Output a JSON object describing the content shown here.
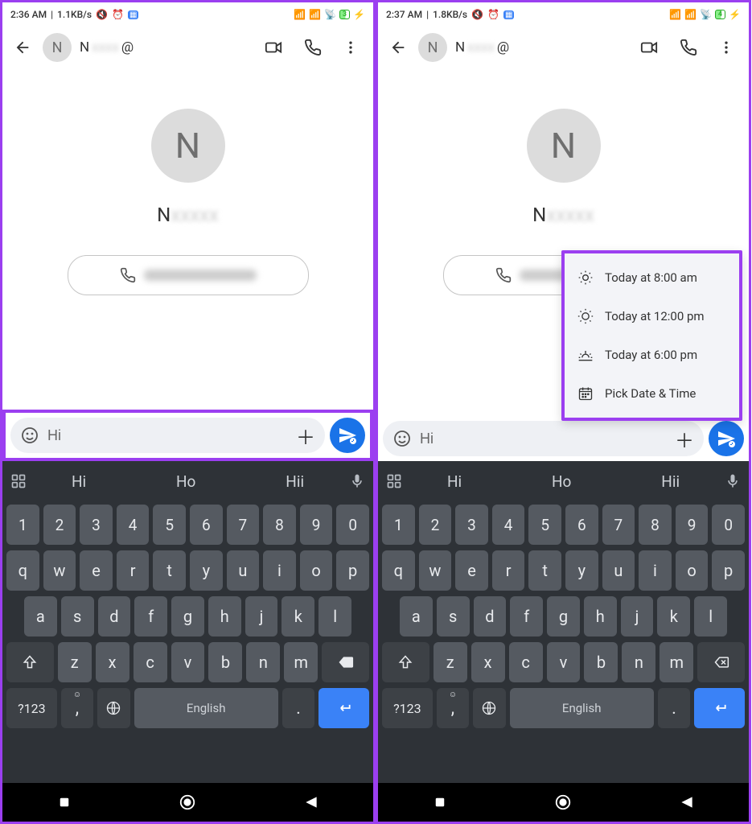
{
  "screens": [
    {
      "status": {
        "time": "2:36 AM",
        "net": "1.1KB/s",
        "battery": "3"
      },
      "input_value": "Hi",
      "highlight_input": true,
      "show_popup": false
    },
    {
      "status": {
        "time": "2:37 AM",
        "net": "1.8KB/s",
        "battery": "4"
      },
      "input_value": "Hi",
      "highlight_input": false,
      "show_popup": true
    }
  ],
  "header": {
    "avatar_letter": "N",
    "contact_short": "N",
    "contact_suffix": "@"
  },
  "contact": {
    "avatar_letter": "N",
    "name_prefix": "N"
  },
  "popup_items": [
    {
      "icon": "sunrise",
      "label": "Today at 8:00 am"
    },
    {
      "icon": "sun",
      "label": "Today at 12:00 pm"
    },
    {
      "icon": "sunset",
      "label": "Today at 6:00 pm"
    },
    {
      "icon": "calendar",
      "label": "Pick Date & Time"
    }
  ],
  "keyboard": {
    "suggestions": [
      "Hi",
      "Ho",
      "Hii"
    ],
    "row_num": [
      "1",
      "2",
      "3",
      "4",
      "5",
      "6",
      "7",
      "8",
      "9",
      "0"
    ],
    "row1": [
      "q",
      "w",
      "e",
      "r",
      "t",
      "y",
      "u",
      "i",
      "o",
      "p"
    ],
    "row2": [
      "a",
      "s",
      "d",
      "f",
      "g",
      "h",
      "j",
      "k",
      "l"
    ],
    "row3": [
      "z",
      "x",
      "c",
      "v",
      "b",
      "n",
      "m"
    ],
    "sym_key": "?123",
    "comma": ",",
    "space": "English",
    "period": "."
  },
  "icons": {
    "alarm": "⏰",
    "square": "▦"
  }
}
